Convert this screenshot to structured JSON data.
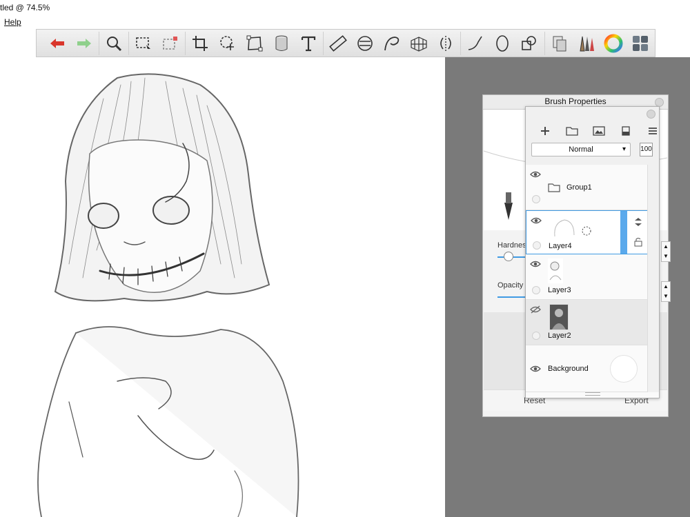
{
  "window": {
    "title": "tled @ 74.5%"
  },
  "menu": {
    "help": "Help"
  },
  "toolbar": {
    "tools": [
      "undo-icon",
      "redo-icon",
      "zoom-icon",
      "selection-icon",
      "transform-selection-icon",
      "crop-icon",
      "lasso-icon",
      "distort-icon",
      "shape-icon",
      "text-icon",
      "ruler-icon",
      "ellipse-guide-icon",
      "french-curve-icon",
      "perspective-icon",
      "symmetry-icon",
      "stroke-icon",
      "circle-icon",
      "shapes-icon",
      "copy-icon",
      "brush-library-icon",
      "color-wheel-icon",
      "palette-icon"
    ]
  },
  "brush_properties": {
    "title": "Brush Properties",
    "hardness_label": "Hardnes",
    "opacity_label": "Opacity",
    "reset_label": "Reset",
    "export_label": "Export"
  },
  "layers": {
    "blend_mode": "Normal",
    "opacity_value": "100",
    "items": [
      {
        "name": "Group1",
        "visible": true
      },
      {
        "name": "Layer4",
        "visible": true,
        "selected": true
      },
      {
        "name": "Layer3",
        "visible": true
      },
      {
        "name": "Layer2",
        "visible": false
      },
      {
        "name": "Background",
        "visible": true
      }
    ]
  },
  "colors": {
    "gray_area": "#7a7a7a",
    "selection_blue": "#3f9ae3",
    "undo_red": "#d9362b",
    "redo_green": "#7ec87b"
  }
}
